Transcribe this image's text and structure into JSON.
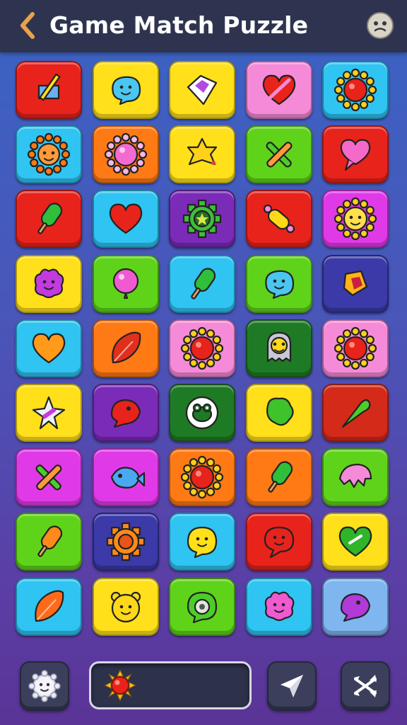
{
  "header": {
    "title": "Game Match Puzzle",
    "back_icon": "chevron-left-icon",
    "profile_icon": "face-icon"
  },
  "colors": {
    "red": "#e8231c",
    "yellow": "#ffe01a",
    "pink": "#f58bd8",
    "cyan": "#2fc4f2",
    "orange": "#ff7a14",
    "green": "#5fd31a",
    "purple": "#7a2bb8",
    "magenta": "#e03ae8",
    "navy": "#3b3aa8",
    "darkgreen": "#1f7a26",
    "deepred": "#d42a1a",
    "lightblue": "#7fb6f0"
  },
  "board": {
    "rows": [
      [
        {
          "color": "red",
          "icon": "sword-block-icon"
        },
        {
          "color": "yellow",
          "icon": "blue-blob-icon"
        },
        {
          "color": "yellow",
          "icon": "purple-gem-icon"
        },
        {
          "color": "pink",
          "icon": "broken-heart-icon"
        },
        {
          "color": "cyan",
          "icon": "sun-icon"
        }
      ],
      [
        {
          "color": "cyan",
          "icon": "flower-face-icon"
        },
        {
          "color": "orange",
          "icon": "pink-flower-icon"
        },
        {
          "color": "yellow",
          "icon": "star-blob-icon"
        },
        {
          "color": "green",
          "icon": "crossed-sticks-icon"
        },
        {
          "color": "red",
          "icon": "pink-heart-bubble-icon"
        }
      ],
      [
        {
          "color": "red",
          "icon": "green-popsicle-icon"
        },
        {
          "color": "cyan",
          "icon": "red-heart-icon"
        },
        {
          "color": "purple",
          "icon": "gear-star-icon"
        },
        {
          "color": "red",
          "icon": "candy-icon"
        },
        {
          "color": "magenta",
          "icon": "smiling-sun-icon"
        }
      ],
      [
        {
          "color": "yellow",
          "icon": "purple-monster-icon"
        },
        {
          "color": "green",
          "icon": "pink-balloon-icon"
        },
        {
          "color": "cyan",
          "icon": "green-popsicle-icon"
        },
        {
          "color": "green",
          "icon": "blue-blob-icon"
        },
        {
          "color": "navy",
          "icon": "gem-box-icon"
        }
      ],
      [
        {
          "color": "cyan",
          "icon": "orange-heart-icon"
        },
        {
          "color": "orange",
          "icon": "red-leaf-icon"
        },
        {
          "color": "pink",
          "icon": "red-sun-icon"
        },
        {
          "color": "darkgreen",
          "icon": "yellow-ghost-icon"
        },
        {
          "color": "pink",
          "icon": "red-sun-icon"
        }
      ],
      [
        {
          "color": "yellow",
          "icon": "white-star-icon"
        },
        {
          "color": "purple",
          "icon": "red-bird-icon"
        },
        {
          "color": "darkgreen",
          "icon": "frog-bubble-icon"
        },
        {
          "color": "yellow",
          "icon": "green-blob-icon"
        },
        {
          "color": "deepred",
          "icon": "green-cone-icon"
        }
      ],
      [
        {
          "color": "magenta",
          "icon": "crossed-sticks-icon"
        },
        {
          "color": "magenta",
          "icon": "blue-fish-icon"
        },
        {
          "color": "orange",
          "icon": "red-sun-icon"
        },
        {
          "color": "orange",
          "icon": "green-popsicle-icon"
        },
        {
          "color": "green",
          "icon": "pink-shell-icon"
        }
      ],
      [
        {
          "color": "green",
          "icon": "orange-popsicle-icon"
        },
        {
          "color": "navy",
          "icon": "orange-gear-icon"
        },
        {
          "color": "cyan",
          "icon": "yellow-smiley-icon"
        },
        {
          "color": "red",
          "icon": "red-face-bubble-icon"
        },
        {
          "color": "yellow",
          "icon": "green-heart-icon"
        }
      ],
      [
        {
          "color": "cyan",
          "icon": "orange-leaf-icon"
        },
        {
          "color": "yellow",
          "icon": "yellow-bear-icon"
        },
        {
          "color": "green",
          "icon": "green-gear-bubble-icon"
        },
        {
          "color": "cyan",
          "icon": "pink-monster-icon"
        },
        {
          "color": "lightblue",
          "icon": "purple-bird-icon"
        }
      ]
    ]
  },
  "footer": {
    "settings_icon": "gear-face-icon",
    "power_icon": "sun-icon",
    "launch_icon": "paper-plane-icon",
    "shuffle_icon": "shuffle-icon"
  }
}
